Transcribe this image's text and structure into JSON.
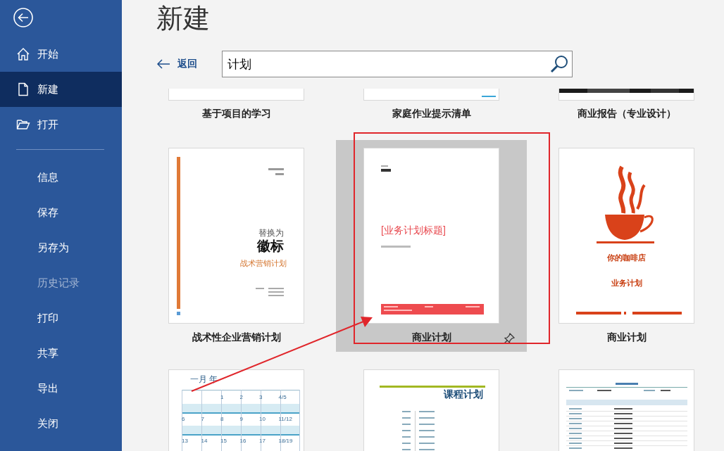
{
  "sidebar": {
    "items": [
      {
        "label": "开始",
        "selected": false,
        "disabled": false
      },
      {
        "label": "新建",
        "selected": true,
        "disabled": false
      },
      {
        "label": "打开",
        "selected": false,
        "disabled": false
      },
      {
        "label": "信息",
        "selected": false,
        "disabled": false
      },
      {
        "label": "保存",
        "selected": false,
        "disabled": false
      },
      {
        "label": "另存为",
        "selected": false,
        "disabled": false
      },
      {
        "label": "历史记录",
        "selected": false,
        "disabled": true
      },
      {
        "label": "打印",
        "selected": false,
        "disabled": false
      },
      {
        "label": "共享",
        "selected": false,
        "disabled": false
      },
      {
        "label": "导出",
        "selected": false,
        "disabled": false
      },
      {
        "label": "关闭",
        "selected": false,
        "disabled": false
      }
    ]
  },
  "title": "新建",
  "back": {
    "label": "返回"
  },
  "search": {
    "value": "计划"
  },
  "templates": [
    {
      "kind": "project",
      "label": "基于项目的学习",
      "selected": false
    },
    {
      "kind": "homework",
      "label": "家庭作业提示清单",
      "selected": false
    },
    {
      "kind": "report",
      "label": "商业报告（专业设计）",
      "selected": false
    },
    {
      "kind": "marketing",
      "label": "战术性企业营销计划",
      "selected": false,
      "preview": [
        "替换为",
        "徽标",
        "战术营销计划"
      ]
    },
    {
      "kind": "business",
      "label": "商业计划",
      "selected": true,
      "preview": [
        "[业务计划标题]"
      ]
    },
    {
      "kind": "coffee",
      "label": "商业计划",
      "selected": false,
      "preview": [
        "你的咖啡店",
        "业务计划"
      ]
    },
    {
      "kind": "calendar",
      "selected": false,
      "preview": [
        "一月 年"
      ],
      "rows": [
        [
          "",
          "",
          "1",
          "2",
          "3",
          "4/5"
        ],
        [
          "6",
          "7",
          "8",
          "9",
          "10",
          "11/12"
        ],
        [
          "13",
          "14",
          "15",
          "16",
          "17",
          "18/19"
        ]
      ]
    },
    {
      "kind": "course",
      "selected": false,
      "preview": [
        "课程计划"
      ]
    },
    {
      "kind": "itinerary",
      "selected": false
    }
  ]
}
